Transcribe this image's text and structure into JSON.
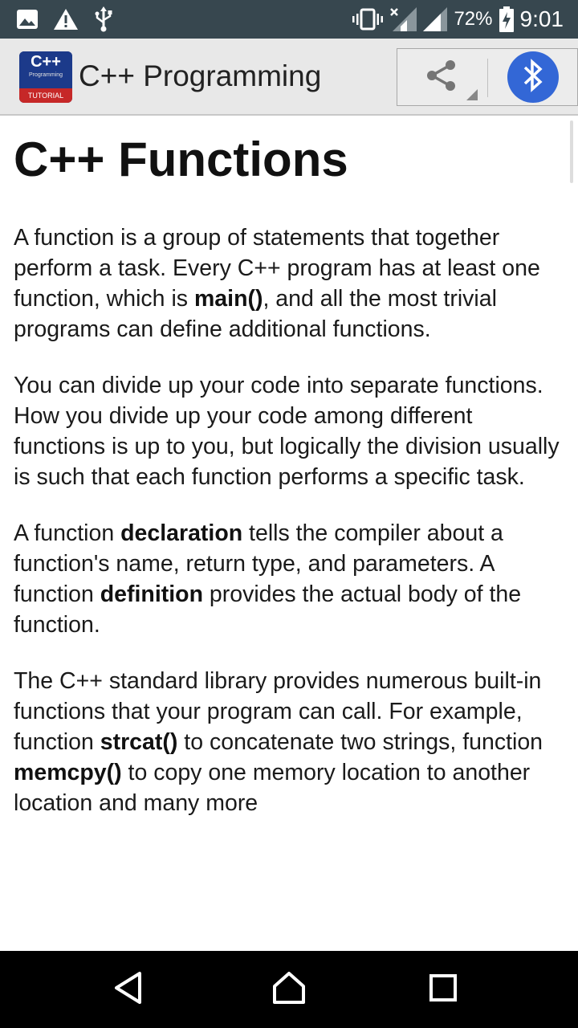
{
  "status_bar": {
    "battery_percent": "72%",
    "time": "9:01",
    "icons": [
      "image-icon",
      "warning-icon",
      "usb-icon",
      "vibrate-icon",
      "no-signal-icon",
      "signal-icon",
      "battery-charging-icon"
    ]
  },
  "action_bar": {
    "app_icon": {
      "top_text": "C++",
      "sub_text": "Programming",
      "bottom_text": "TUTORIAL"
    },
    "title": "C++ Programming",
    "share_icon": "share-icon",
    "bluetooth_icon": "bluetooth-icon",
    "colors": {
      "bluetooth_bg": "#3367d6",
      "status_bar_bg": "#37474f",
      "action_bar_bg": "#e8e8e8"
    }
  },
  "content": {
    "title": "C++ Functions",
    "paragraphs": [
      [
        {
          "text": "A function is a group of statements that together perform a task. Every C++ program has at least one function, which is "
        },
        {
          "text": "main()",
          "bold": true
        },
        {
          "text": ", and all the most trivial programs can define additional functions."
        }
      ],
      [
        {
          "text": "You can divide up your code into separate functions. How you divide up your code among different functions is up to you, but logically the division usually is such that each function performs a specific task."
        }
      ],
      [
        {
          "text": "A function "
        },
        {
          "text": "declaration",
          "bold": true
        },
        {
          "text": " tells the compiler about a function's name, return type, and parameters. A function "
        },
        {
          "text": "definition",
          "bold": true
        },
        {
          "text": " provides the actual body of the function."
        }
      ],
      [
        {
          "text": "The C++ standard library provides numerous built-in functions that your program can call. For example, function "
        },
        {
          "text": "strcat()",
          "bold": true
        },
        {
          "text": " to concatenate two strings, function "
        },
        {
          "text": "memcpy()",
          "bold": true
        },
        {
          "text": " to copy one memory location to another location and many more"
        }
      ]
    ]
  },
  "nav_bar": {
    "icons": [
      "back-icon",
      "home-icon",
      "recents-icon"
    ]
  }
}
